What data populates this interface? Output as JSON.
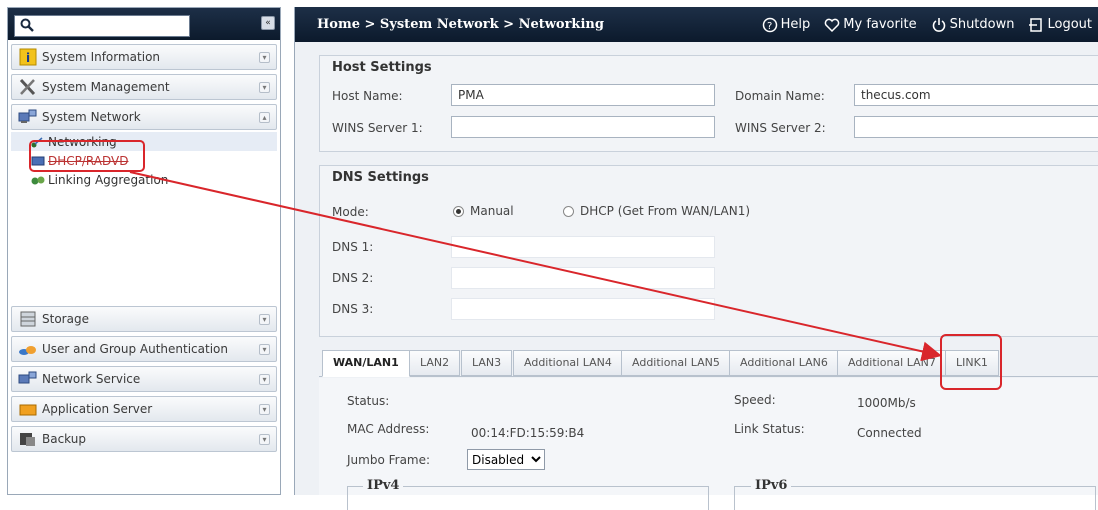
{
  "sidebar": {
    "search": {
      "placeholder": "",
      "value": ""
    },
    "collapse_label": "«",
    "items": [
      {
        "label": "System Information",
        "icon": "info-icon"
      },
      {
        "label": "System Management",
        "icon": "tools-icon"
      },
      {
        "label": "System Network",
        "icon": "network-icon",
        "expanded": true
      }
    ],
    "submenu": [
      {
        "label": "Networking",
        "icon": "networking-icon",
        "active": true
      },
      {
        "label": "DHCP/RADVD",
        "icon": "dhcp-icon"
      },
      {
        "label": "Linking Aggregation",
        "icon": "link-aggregation-icon"
      }
    ],
    "lower_items": [
      {
        "label": "Storage",
        "icon": "storage-icon"
      },
      {
        "label": "User and Group Authentication",
        "icon": "users-icon"
      },
      {
        "label": "Network Service",
        "icon": "network-service-icon"
      },
      {
        "label": "Application Server",
        "icon": "app-server-icon"
      },
      {
        "label": "Backup",
        "icon": "backup-icon"
      }
    ]
  },
  "header": {
    "breadcrumb": "Home > System Network > Networking",
    "help": "Help",
    "favorite": "My favorite",
    "shutdown": "Shutdown",
    "logout": "Logout"
  },
  "host": {
    "title": "Host Settings",
    "host_name_label": "Host Name:",
    "host_name_value": "PMA",
    "domain_name_label": "Domain Name:",
    "domain_name_value": "thecus.com",
    "wins1_label": "WINS Server 1:",
    "wins1_value": "",
    "wins2_label": "WINS Server 2:",
    "wins2_value": ""
  },
  "dns": {
    "title": "DNS Settings",
    "mode_label": "Mode:",
    "mode_manual": "Manual",
    "mode_dhcp": "DHCP (Get From WAN/LAN1)",
    "selected_mode": "manual",
    "dns1_label": "DNS 1:",
    "dns2_label": "DNS 2:",
    "dns3_label": "DNS 3:",
    "dns1_value": "",
    "dns2_value": "",
    "dns3_value": ""
  },
  "tabs": [
    "WAN/LAN1",
    "LAN2",
    "LAN3",
    "Additional LAN4",
    "Additional LAN5",
    "Additional LAN6",
    "Additional LAN7",
    "LINK1"
  ],
  "active_tab": "WAN/LAN1",
  "wan": {
    "status_label": "Status:",
    "status_value": "",
    "speed_label": "Speed:",
    "speed_value": "1000Mb/s",
    "mac_label": "MAC Address:",
    "mac_value": "00:14:FD:15:59:B4",
    "link_status_label": "Link Status:",
    "link_status_value": "Connected",
    "jumbo_label": "Jumbo Frame:",
    "jumbo_value": "Disabled",
    "ipv4_label": "IPv4",
    "ipv6_label": "IPv6"
  },
  "colors": {
    "annotation_red": "#d9262b",
    "header_navy": "#14263d"
  }
}
